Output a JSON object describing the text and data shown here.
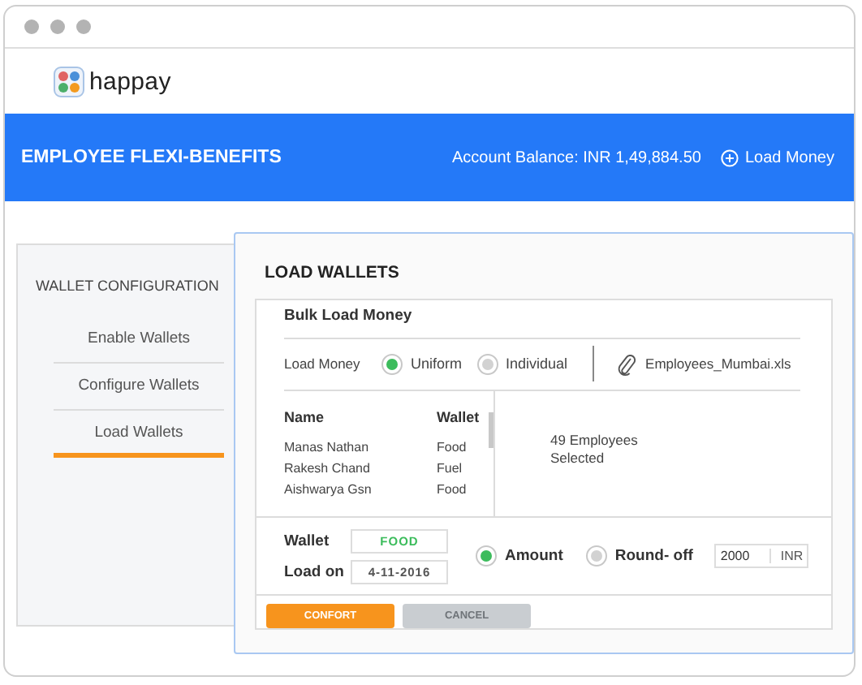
{
  "logo": {
    "text": "happay"
  },
  "header": {
    "title": "EMPLOYEE FLEXI-BENEFITS",
    "balance": "Account Balance: INR 1,49,884.50",
    "action": "Load Money"
  },
  "sidebar": {
    "title": "WALLET CONFIGURATION",
    "items": [
      {
        "label": "Enable Wallets",
        "selected": false
      },
      {
        "label": "Configure Wallets",
        "selected": false
      },
      {
        "label": "Load Wallets",
        "selected": true
      }
    ]
  },
  "modal": {
    "title": "LOAD WALLETS",
    "section_title": "Bulk Load Money",
    "load_money": {
      "label": "Load Money",
      "options": [
        {
          "label": "Uniform",
          "selected": true
        },
        {
          "label": "Individual",
          "selected": false
        }
      ]
    },
    "file": "Employees_Mumbai.xls",
    "table": {
      "columns": [
        "Name",
        "Wallet"
      ],
      "rows": [
        [
          "Manas Nathan",
          "Food"
        ],
        [
          "Rakesh Chand",
          "Fuel"
        ],
        [
          "Aishwarya Gsn",
          "Food"
        ]
      ]
    },
    "summary": "49 Employees Selected",
    "form": {
      "wallet_label": "Wallet",
      "wallet_value": "FOOD",
      "load_on_label": "Load on",
      "load_on_value": "4-11-2016",
      "mode_options": [
        {
          "label": "Amount",
          "selected": true
        },
        {
          "label": "Round- off",
          "selected": false
        }
      ],
      "amount": "2000",
      "currency": "INR"
    },
    "buttons": [
      {
        "label": "CONFORT",
        "kind": "primary"
      },
      {
        "label": "CANCEL",
        "kind": "disabled"
      }
    ]
  }
}
